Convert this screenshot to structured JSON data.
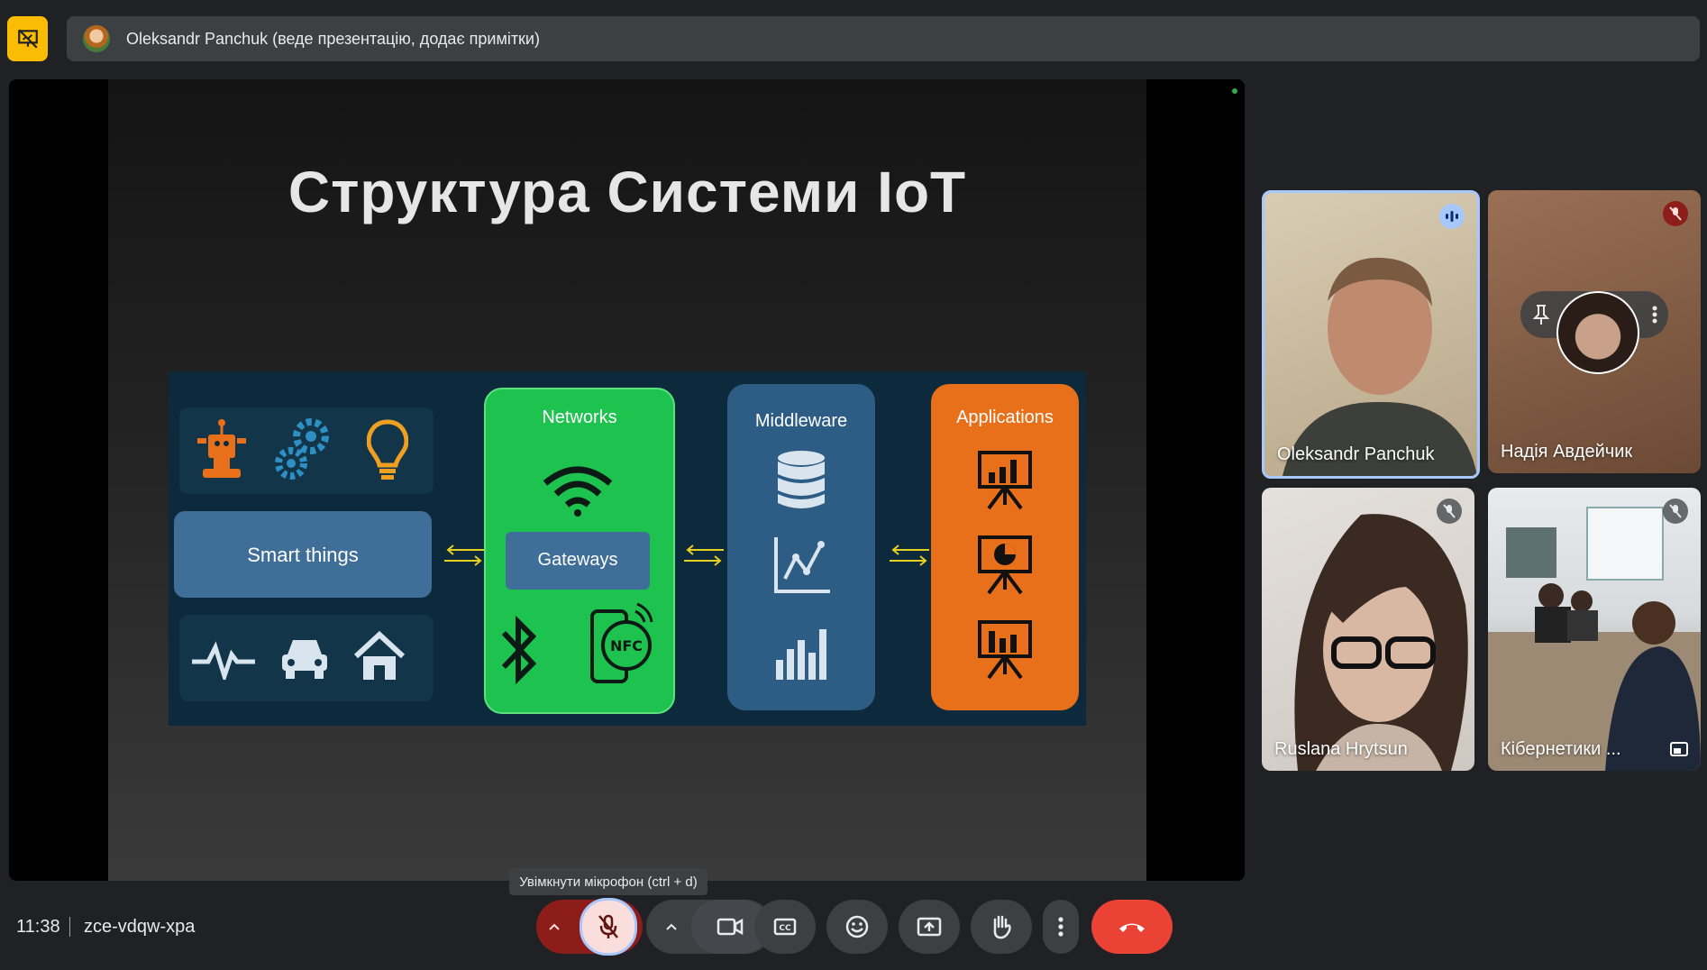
{
  "header": {
    "presenter_text": "Oleksandr Panchuk (веде презентацію, додає примітки)"
  },
  "slide": {
    "title": "Структура Системи IoT",
    "diagram": {
      "smart_things": "Smart things",
      "networks": "Networks",
      "gateways": "Gateways",
      "nfc": "NFC",
      "middleware": "Middleware",
      "applications": "Applications"
    }
  },
  "participants": [
    {
      "name": "Oleksandr Panchuk",
      "status": "speaking"
    },
    {
      "name": "Надія Авдейчик",
      "status": "muted"
    },
    {
      "name": "Ruslana Hrytsun",
      "status": "muted"
    },
    {
      "name": "Кібернетики ...",
      "status": "muted"
    }
  ],
  "footer": {
    "time": "11:38",
    "meeting_code": "zce-vdqw-xpa",
    "tooltip": "Увімкнути мікрофон (ctrl + d)"
  },
  "colors": {
    "present_accent": "#fbbc04",
    "end_call": "#ea4335",
    "mic_off": "#f9dedc",
    "networks": "#1ec24f",
    "middleware": "#2d5d85",
    "applications": "#e8701a",
    "smart_things": "#3f6e98"
  }
}
